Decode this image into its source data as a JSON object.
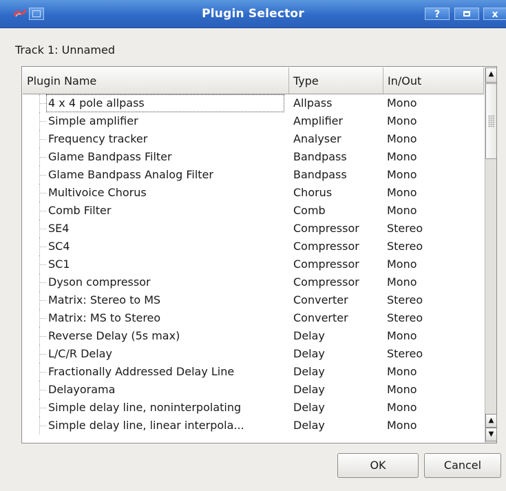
{
  "window": {
    "title": "Plugin Selector",
    "help_label": "?"
  },
  "track_label": "Track 1:  Unnamed",
  "list": {
    "columns": [
      "Plugin Name",
      "Type",
      "In/Out"
    ],
    "rows": [
      {
        "name": "4 x 4 pole allpass",
        "type": "Allpass",
        "io": "Mono"
      },
      {
        "name": "Simple amplifier",
        "type": "Amplifier",
        "io": "Mono"
      },
      {
        "name": "Frequency tracker",
        "type": "Analyser",
        "io": "Mono"
      },
      {
        "name": "Glame Bandpass Filter",
        "type": "Bandpass",
        "io": "Mono"
      },
      {
        "name": "Glame Bandpass Analog Filter",
        "type": "Bandpass",
        "io": "Mono"
      },
      {
        "name": "Multivoice Chorus",
        "type": "Chorus",
        "io": "Mono"
      },
      {
        "name": "Comb Filter",
        "type": "Comb",
        "io": "Mono"
      },
      {
        "name": "SE4",
        "type": "Compressor",
        "io": "Stereo"
      },
      {
        "name": "SC4",
        "type": "Compressor",
        "io": "Stereo"
      },
      {
        "name": "SC1",
        "type": "Compressor",
        "io": "Mono"
      },
      {
        "name": "Dyson compressor",
        "type": "Compressor",
        "io": "Mono"
      },
      {
        "name": "Matrix: Stereo to MS",
        "type": "Converter",
        "io": "Stereo"
      },
      {
        "name": "Matrix: MS to Stereo",
        "type": "Converter",
        "io": "Stereo"
      },
      {
        "name": "Reverse Delay (5s max)",
        "type": "Delay",
        "io": "Mono"
      },
      {
        "name": "L/C/R Delay",
        "type": "Delay",
        "io": "Stereo"
      },
      {
        "name": "Fractionally Addressed Delay Line",
        "type": "Delay",
        "io": "Mono"
      },
      {
        "name": "Delayorama",
        "type": "Delay",
        "io": "Mono"
      },
      {
        "name": "Simple delay line, noninterpolating",
        "type": "Delay",
        "io": "Mono"
      },
      {
        "name": "Simple delay line, linear interpola...",
        "type": "Delay",
        "io": "Mono"
      }
    ]
  },
  "buttons": {
    "ok": "OK",
    "cancel": "Cancel"
  },
  "colors": {
    "titlebar": "#2f6bc8",
    "window_bg": "#eeedea"
  }
}
